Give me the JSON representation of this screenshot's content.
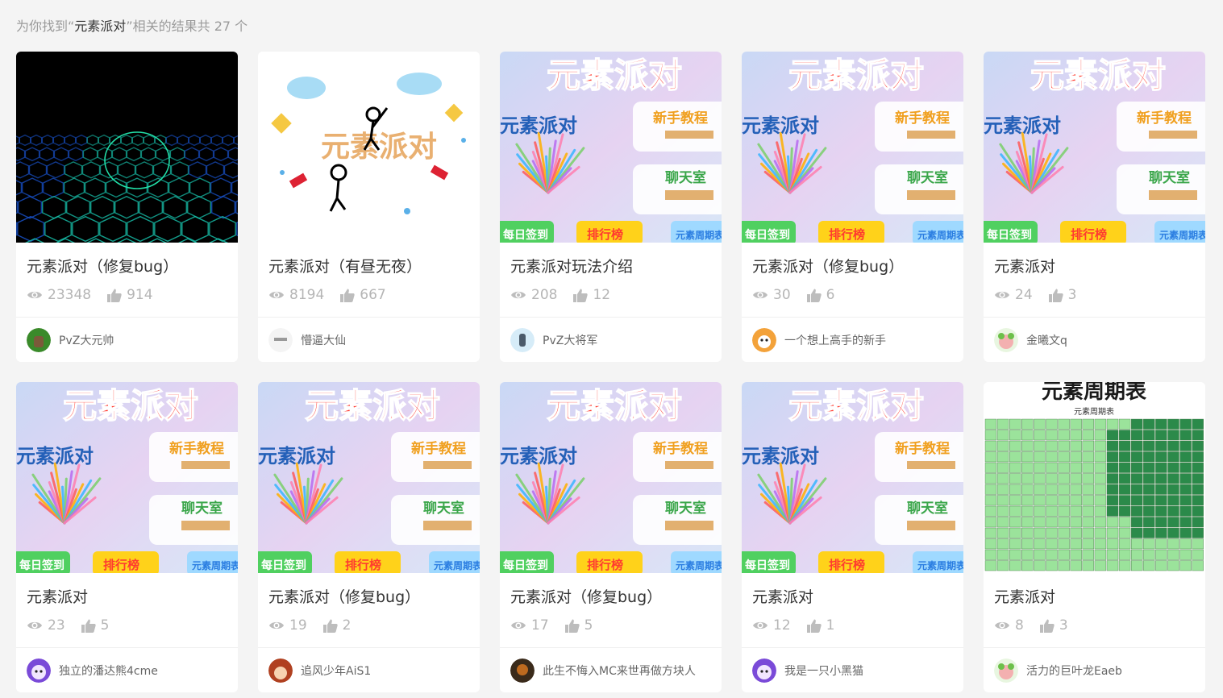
{
  "search": {
    "prefix": "为你找到“",
    "keyword": "元素派对",
    "suffix": "”相关的结果共 27 个"
  },
  "thumb_text": {
    "title": "元素派对",
    "sub": "元素派对",
    "tutorial": "新手教程",
    "chat": "聊天室",
    "checkin": "每日签到",
    "ranking": "排行榜",
    "periodic": "元素周期表",
    "periodic_header": "元素周期表"
  },
  "colors": {
    "accent_title_a": "#ff3b30",
    "accent_title_b": "#2bb5a6",
    "accent_title_c": "#2a7de1"
  },
  "cards": [
    {
      "title": "元素派对（修复bug）",
      "views": "23348",
      "likes": "914",
      "author": "PvZ大元帅",
      "thumb": "hexgrid",
      "avatar": "green"
    },
    {
      "title": "元素派对（有昼无夜）",
      "views": "8194",
      "likes": "667",
      "author": "懵逼大仙",
      "thumb": "stickman",
      "avatar": "white"
    },
    {
      "title": "元素派对玩法介绍",
      "views": "208",
      "likes": "12",
      "author": "PvZ大将军",
      "thumb": "menu",
      "avatar": "blue"
    },
    {
      "title": "元素派对（修复bug）",
      "views": "30",
      "likes": "6",
      "author": "一个想上高手的新手",
      "thumb": "menu",
      "avatar": "fox"
    },
    {
      "title": "元素派对",
      "views": "24",
      "likes": "3",
      "author": "金曦文q",
      "thumb": "menu",
      "avatar": "frog"
    },
    {
      "title": "元素派对",
      "views": "23",
      "likes": "5",
      "author": "独立的潘达熊4cme",
      "thumb": "menu",
      "avatar": "purple"
    },
    {
      "title": "元素派对（修复bug）",
      "views": "19",
      "likes": "2",
      "author": "追风少年AiS1",
      "thumb": "menu",
      "avatar": "boy"
    },
    {
      "title": "元素派对（修复bug）",
      "views": "17",
      "likes": "5",
      "author": "此生不悔入MC来世再做方块人",
      "thumb": "menu",
      "avatar": "dark"
    },
    {
      "title": "元素派对",
      "views": "12",
      "likes": "1",
      "author": "我是一只小黑猫",
      "thumb": "menu2",
      "avatar": "purple"
    },
    {
      "title": "元素派对",
      "views": "8",
      "likes": "3",
      "author": "活力的巨叶龙Eaeb",
      "thumb": "periodic",
      "avatar": "frog"
    }
  ]
}
